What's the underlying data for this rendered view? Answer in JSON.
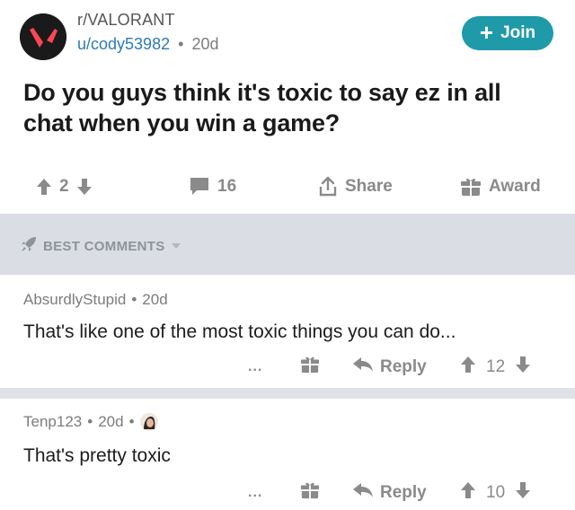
{
  "post": {
    "subreddit": "r/VALORANT",
    "author": "u/cody53982",
    "separator": "•",
    "age": "20d",
    "join_label": "Join",
    "title": "Do you guys think it's toxic to say ez in all chat when you win a game?",
    "votes": "2",
    "comments": "16",
    "share_label": "Share",
    "award_label": "Award"
  },
  "best_comments": {
    "label": "BEST COMMENTS"
  },
  "comments": [
    {
      "author": "AbsurdlyStupid",
      "age": "20d",
      "body": "That's like one of the most toxic things you can do...",
      "more": "...",
      "reply_label": "Reply",
      "votes": "12"
    },
    {
      "author": "Tenp123",
      "age": "20d",
      "body": "That's pretty toxic",
      "more": "...",
      "reply_label": "Reply",
      "votes": "10"
    }
  ],
  "colors": {
    "join_bg": "#1f9aa8",
    "link_blue": "#2a7bb8",
    "valorant_red": "#ff4655",
    "icon_gray": "#8a8a8a",
    "banner_bg": "#dadde4"
  },
  "icons": {
    "subreddit": "valorant-logo",
    "upvote": "arrow-up-icon",
    "downvote": "arrow-down-icon",
    "comment": "speech-bubble-icon",
    "share": "share-icon",
    "award": "gift-icon",
    "best": "rocket-icon",
    "reply": "reply-arrow-icon"
  }
}
